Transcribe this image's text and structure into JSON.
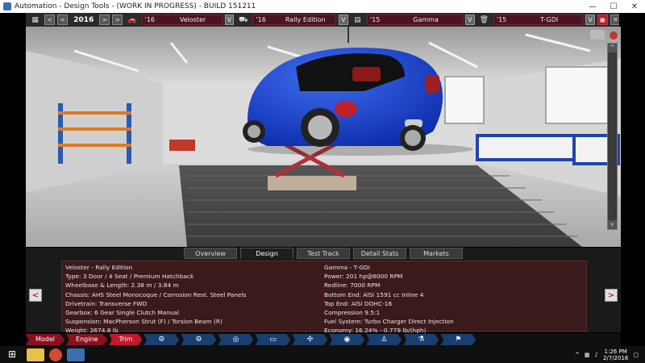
{
  "window": {
    "title": "Automation - Design Tools - (WORK IN PROGRESS) - BUILD 151211",
    "minimize": "—",
    "maximize": "☐",
    "close": "✕"
  },
  "topbar": {
    "year": "2016",
    "prev": "<",
    "prev2": "<",
    "next": ">",
    "next2": ">",
    "model": {
      "year": "'16",
      "name": "Veloster"
    },
    "trim": {
      "year": "'16",
      "name": "Rally Edition"
    },
    "engine": {
      "year": "'15",
      "name": "Gamma"
    },
    "variant": {
      "year": "'15",
      "name": "T-GDI"
    },
    "dropdown": "V",
    "close": "✕"
  },
  "tabs": [
    "Overview",
    "Design",
    "Test Track",
    "Detail Stats",
    "Markets"
  ],
  "active_tab": "Design",
  "car_info": [
    "Veloster - Rally Edition",
    "Type: 3 Door / 4 Seat / Premium Hatchback",
    "Wheelbase & Length: 2.38 m / 3.84 m",
    "Chassis: AHS Steel Monocoque / Corrosion Rest. Steel Panels",
    "Drivetrain: Transverse FWD",
    "Gearbox: 6 Gear Single Clutch Manual",
    "Suspension: MacPherson Strut (F) / Torsion Beam (R)",
    "Weight: 2674.8 lb"
  ],
  "engine_info": [
    "Gamma - T-GDI",
    "Power: 201 hp@6000 RPM",
    "Redline: 7000 RPM",
    "Bottom End: AlSi 1591 cc Inline 4",
    "Top End: AlSi DOHC-16",
    "Compression 9.5:1",
    "Fuel System: Turbo Charger Direct Injection",
    "Economy: 16.24% - 0.779 lb/(hph)"
  ],
  "nav_arrows": {
    "left": "<",
    "right": ">"
  },
  "bottom_nav": [
    "Model",
    "Engine",
    "Trim"
  ],
  "active_bottom": "Trim",
  "taskbar": {
    "time": "1:26 PM",
    "date": "2/7/2016"
  },
  "scrollbar": {
    "up": "^",
    "down": "v"
  }
}
